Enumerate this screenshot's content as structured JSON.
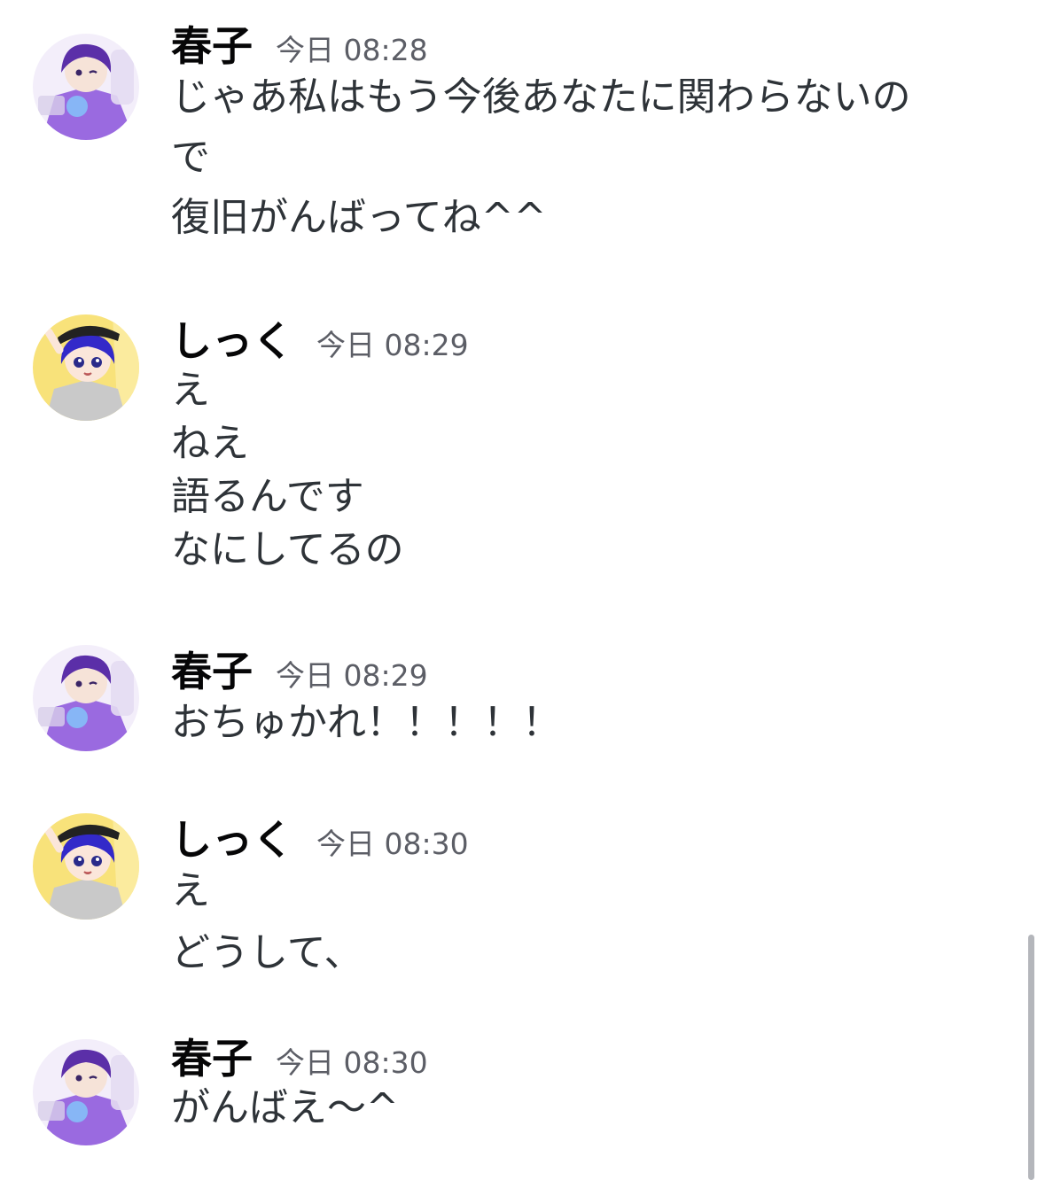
{
  "messages": [
    {
      "username": "春子",
      "timestamp": "今日 08:28",
      "avatar": "haruko-avatar",
      "lines": [
        "じゃあ私はもう今後あなたに関わらないの",
        "で",
        "復旧がんばってね^^"
      ]
    },
    {
      "username": "しっく",
      "timestamp": "今日 08:29",
      "avatar": "shikku-avatar",
      "lines": [
        "え",
        "ねえ",
        "語るんです",
        "なにしてるの"
      ]
    },
    {
      "username": "春子",
      "timestamp": "今日 08:29",
      "avatar": "haruko-avatar",
      "lines": [
        "おちゅかれ！！！！！"
      ]
    },
    {
      "username": "しっく",
      "timestamp": "今日 08:30",
      "avatar": "shikku-avatar",
      "lines": [
        "え",
        "どうして、"
      ]
    },
    {
      "username": "春子",
      "timestamp": "今日 08:30",
      "avatar": "haruko-avatar",
      "lines": [
        "がんばえ〜^"
      ]
    }
  ],
  "colors": {
    "username": "#060607",
    "timestamp": "#5c5e66",
    "text": "#2e3338",
    "haruko_accent": "#7b4fd0",
    "shikku_accent": "#3b2fd6",
    "shikku_bg": "#f8e27a"
  }
}
